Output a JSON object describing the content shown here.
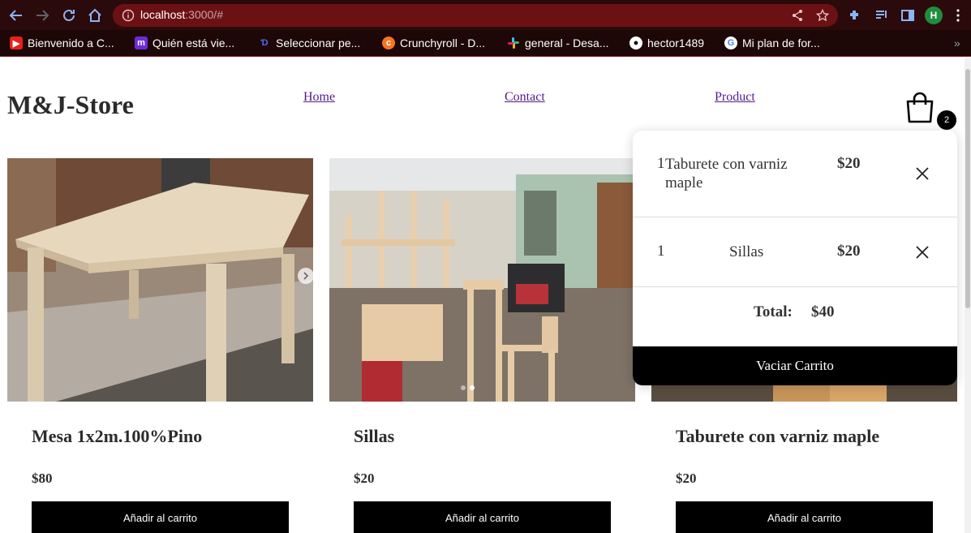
{
  "browser": {
    "url_host": "localhost",
    "url_rest": ":3000/#",
    "profile_initial": "H",
    "bookmarks": [
      {
        "label": "Bienvenido a C...",
        "icon": "opera-icon",
        "color": "#e62117"
      },
      {
        "label": "Quién está vie...",
        "icon": "m-app-icon",
        "color": "#6d2bd9"
      },
      {
        "label": "Seleccionar pe...",
        "icon": "disney-icon",
        "color": "#1a3fd6"
      },
      {
        "label": "Crunchyroll - D...",
        "icon": "crunchyroll-icon",
        "color": "#f47521"
      },
      {
        "label": "general - Desa...",
        "icon": "slack-icon",
        "color": "#e01e5a"
      },
      {
        "label": "hector1489",
        "icon": "github-icon",
        "color": "#333333"
      },
      {
        "label": "Mi plan de for...",
        "icon": "google-icon",
        "color": "#ffffff"
      }
    ],
    "more": "»"
  },
  "site": {
    "logo": "M&J-Store",
    "nav": [
      {
        "label": "Home"
      },
      {
        "label": "Contact"
      },
      {
        "label": "Product"
      }
    ],
    "cart_count": "2"
  },
  "products": [
    {
      "title": "Mesa 1x2m.100%Pino",
      "price": "$80",
      "button": "Añadir al carrito",
      "image": "wooden-table-photo"
    },
    {
      "title": "Sillas",
      "price": "$20",
      "button": "Añadir al carrito",
      "image": "chairs-workshop-photo"
    },
    {
      "title": "Taburete con varniz maple",
      "price": "$20",
      "button": "Añadir al carrito",
      "image": "stool-photo"
    }
  ],
  "cart": {
    "items": [
      {
        "qty": "1",
        "name": "Taburete con varniz maple",
        "price": "$20"
      },
      {
        "qty": "1",
        "name": "Sillas",
        "price": "$20"
      }
    ],
    "total_label": "Total:",
    "total_value": "$40",
    "empty_button": "Vaciar Carrito"
  },
  "colors": {
    "chrome_bg": "#2b0a0b",
    "urlbar_bg": "#6b1114",
    "link": "#551a8b",
    "button_bg": "#000000"
  }
}
